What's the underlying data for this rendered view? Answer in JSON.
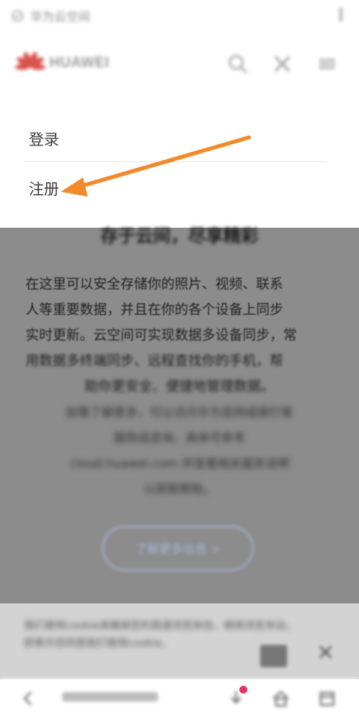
{
  "urlbar": {
    "url_text": "华为云空间"
  },
  "site": {
    "brand": "HUAWEI"
  },
  "menu": {
    "items": [
      "登录",
      "注册"
    ]
  },
  "content": {
    "title": "存于云间，尽享精彩",
    "para1": [
      "在这里可以安全存储你的照片、视频、联系",
      "人等重要数据，并且在你的各个设备上同步",
      "实时更新。云空间可实现数据多设备同步，常",
      "用数据多终端同步、远程查找你的手机，帮",
      "助你更安全、便捷地管理数据。"
    ],
    "para2": [
      "如需了解更多，可以访问华为官网或拨打客",
      "服热线咨询，具体可参考",
      "cloud.huawei.com 并查看相关服务说明",
      "以获取帮助。"
    ],
    "link_label": "了解更多信息 >"
  },
  "cookie": {
    "text": "我们使用cookie来确保您的高速浏览体验，继续浏览本站，即表示您同意我们使用cookie。"
  },
  "colors": {
    "arrow": "#F08A2A",
    "overlay": "#8C8C8C",
    "badge": "#E8335A"
  }
}
